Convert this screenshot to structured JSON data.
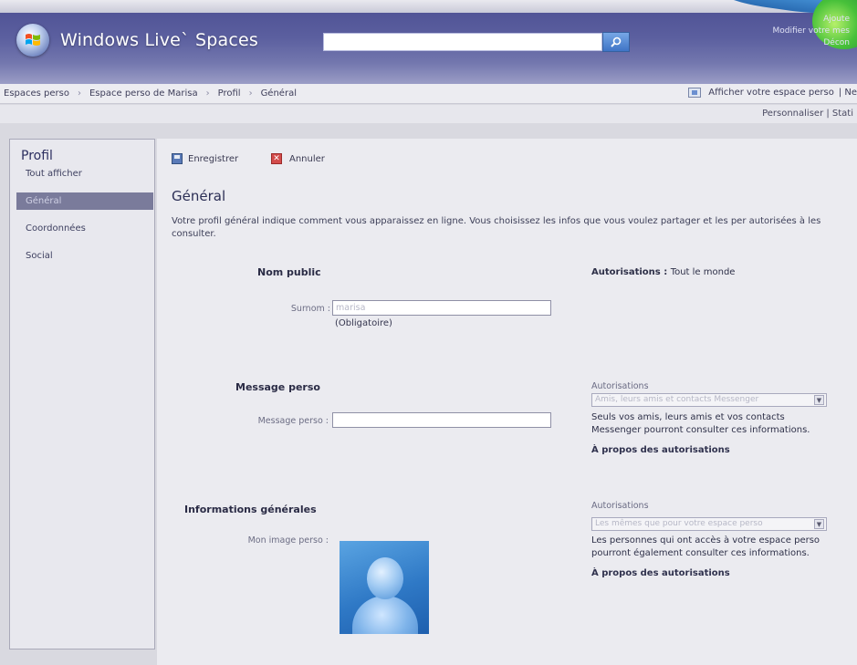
{
  "header": {
    "brand": "Windows Live` Spaces",
    "search_placeholder": "",
    "right_links": [
      "Ajoute",
      "Modifier votre mes",
      "Décon"
    ]
  },
  "breadcrumb": {
    "items": [
      "Espaces perso",
      "Espace perso de Marisa",
      "Profil",
      "Général"
    ],
    "view_space": "Afficher votre espace perso",
    "view_space_extra": "| Ne"
  },
  "subbar": {
    "links": "Personnaliser | Stati"
  },
  "sidebar": {
    "title": "Profil",
    "items": [
      "Tout afficher",
      "Général",
      "Coordonnées",
      "Social"
    ]
  },
  "toolbar": {
    "save_label": "Enregistrer",
    "cancel_label": "Annuler"
  },
  "main": {
    "title": "Général",
    "intro": "Votre profil général indique comment vous apparaissez en ligne. Vous choisissez les infos que vous voulez partager et les per autorisées à les consulter.",
    "public_name": {
      "heading": "Nom public",
      "nickname_label": "Surnom :",
      "nickname_value": "marisa",
      "required_note": "(Obligatoire)",
      "perm_label": "Autorisations :",
      "perm_value": "Tout le monde"
    },
    "personal_message": {
      "heading": "Message perso",
      "field_label": "Message perso :",
      "field_value": "",
      "perm_heading": "Autorisations",
      "perm_select": "Amis, leurs amis et contacts Messenger",
      "perm_desc_1": "Seuls vos amis, leurs amis et vos contacts",
      "perm_desc_2": "Messenger pourront consulter ces informations.",
      "about_link": "À propos des autorisations"
    },
    "general_info": {
      "heading": "Informations générales",
      "image_label": "Mon image perso :",
      "perm_heading": "Autorisations",
      "perm_select": "Les mêmes que pour votre espace perso",
      "perm_desc_1": "Les personnes qui ont accès à votre espace perso",
      "perm_desc_2": "pourront également consulter ces informations.",
      "about_link": "À propos des autorisations"
    }
  },
  "colors": {
    "header_top": "#4c4f92",
    "sidebar_active": "#7a7b9b",
    "search_button": "#3f74c6"
  }
}
